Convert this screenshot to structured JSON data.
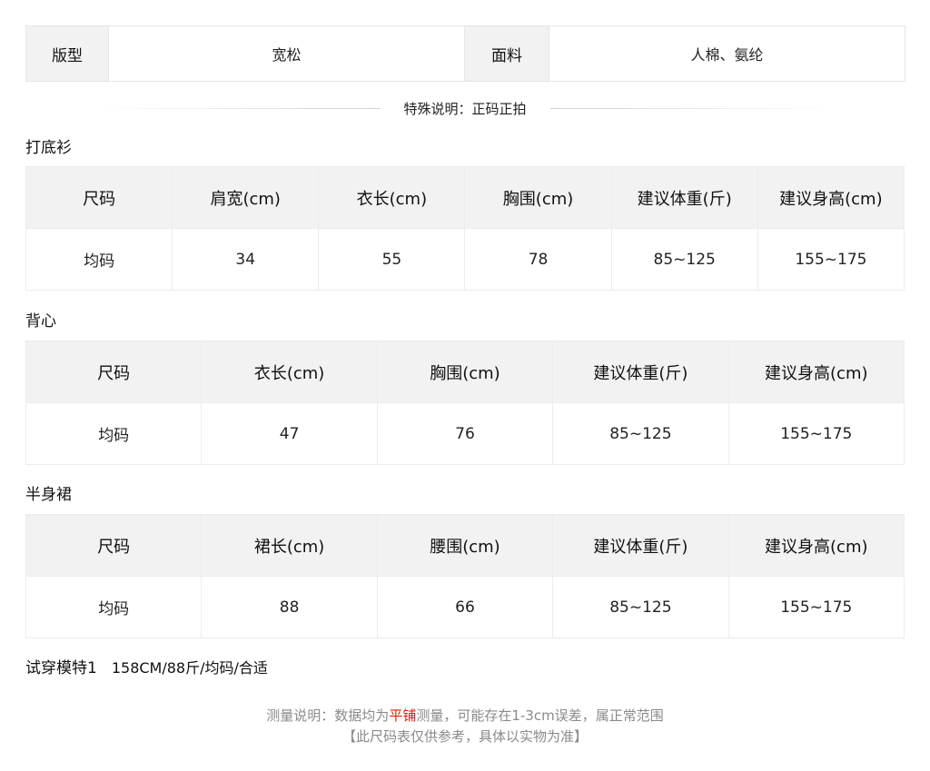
{
  "attributes": {
    "fit_label": "版型",
    "fit_value": "宽松",
    "fabric_label": "面料",
    "fabric_value": "人棉、氨纶"
  },
  "special_note": "特殊说明：正码正拍",
  "sections": [
    {
      "title": "打底衫",
      "headers": [
        "尺码",
        "肩宽(cm)",
        "衣长(cm)",
        "胸围(cm)",
        "建议体重(斤)",
        "建议身高(cm)"
      ],
      "row": [
        "均码",
        "34",
        "55",
        "78",
        "85~125",
        "155~175"
      ]
    },
    {
      "title": "背心",
      "headers": [
        "尺码",
        "衣长(cm)",
        "胸围(cm)",
        "建议体重(斤)",
        "建议身高(cm)"
      ],
      "row": [
        "均码",
        "47",
        "76",
        "85~125",
        "155~175"
      ]
    },
    {
      "title": "半身裙",
      "headers": [
        "尺码",
        "裙长(cm)",
        "腰围(cm)",
        "建议体重(斤)",
        "建议身高(cm)"
      ],
      "row": [
        "均码",
        "88",
        "66",
        "85~125",
        "155~175"
      ]
    }
  ],
  "model": {
    "label": "试穿模特1",
    "value": "158CM/88斤/均码/合适"
  },
  "footer": {
    "line1_prefix": "测量说明：数据均为",
    "line1_highlight": "平铺",
    "line1_suffix": "测量，可能存在1-3cm误差，属正常范围",
    "line2": "【此尺码表仅供参考，具体以实物为准】"
  },
  "colors": {
    "header_bg": "#f2f2f2",
    "border": "#e6e6e6",
    "highlight": "#d81e06",
    "footer_text": "#8a8a8a"
  }
}
